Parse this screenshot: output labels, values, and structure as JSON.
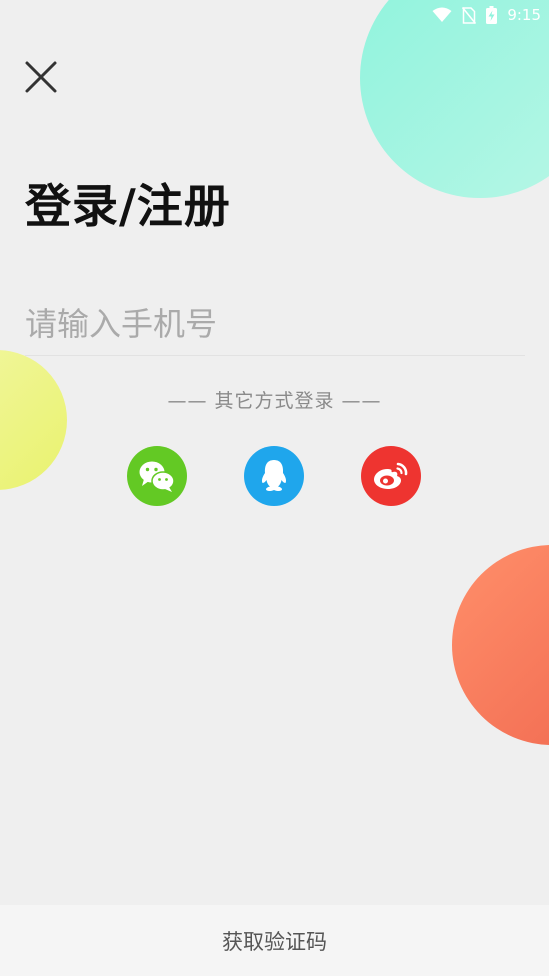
{
  "status_bar": {
    "time": "9:15",
    "icons": [
      "wifi-icon",
      "no-sim-icon",
      "battery-charging-icon"
    ]
  },
  "header": {
    "close_icon": "close-icon",
    "title": "登录/注册"
  },
  "login_form": {
    "phone_placeholder": "请输入手机号",
    "phone_value": ""
  },
  "other_login": {
    "label": "—— 其它方式登录 ——",
    "methods": [
      {
        "icon": "wechat-icon",
        "color": "#63c924"
      },
      {
        "icon": "qq-icon",
        "color": "#1fa6ec"
      },
      {
        "icon": "weibo-icon",
        "color": "#ee3430"
      }
    ]
  },
  "footer": {
    "get_code_label": "获取验证码"
  },
  "colors": {
    "background": "#efefef",
    "bubble_mint": "#a7f5e2",
    "bubble_yellow": "#ecf488",
    "bubble_orange": "#f5775a"
  }
}
